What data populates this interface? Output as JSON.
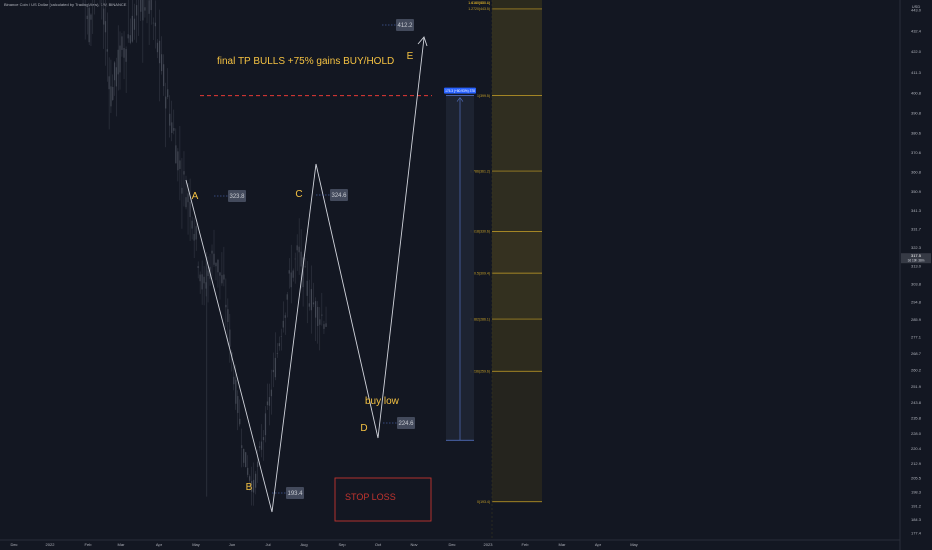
{
  "header": {
    "title": "Binance Coin / US Dollar (calculated by TradingView), 1W, BINANCE"
  },
  "chart_data": {
    "type": "candlestick",
    "x_ticks": [
      "Dec",
      "2022",
      "Feb",
      "Mar",
      "Apr",
      "May",
      "Jun",
      "Jul",
      "Aug",
      "Sep",
      "Oct",
      "Nov",
      "Dec",
      "2023",
      "Feb",
      "Mar",
      "Apr",
      "May"
    ],
    "y_ticks": [
      443.0,
      432.4,
      422.0,
      411.3,
      400.8,
      390.8,
      380.6,
      370.6,
      360.8,
      350.9,
      341.3,
      331.7,
      322.3,
      313.0,
      303.8,
      294.8,
      285.9,
      277.1,
      268.7,
      260.2,
      251.9,
      243.8,
      235.8,
      228.0,
      220.4,
      212.9,
      205.5,
      198.3,
      191.2,
      184.3,
      177.4
    ],
    "ylim": [
      176,
      446
    ],
    "top_label": "USD",
    "price_tag": {
      "value": "317.5",
      "countdown": "3d 19h 38m"
    },
    "waves": [
      {
        "label": "A",
        "price": 323.8
      },
      {
        "label": "B",
        "price": 193.4
      },
      {
        "label": "C",
        "price": 324.6
      },
      {
        "label": "D",
        "price": 224.6
      },
      {
        "label": "E",
        "price": 412.2
      }
    ],
    "target_line": 399.5,
    "annotations": {
      "target": "final TP BULLS +75% gains BUY/HOLD",
      "buy": "buy low",
      "stop": "STOP LOSS"
    },
    "range_box": {
      "from": 224.6,
      "to": 399.5,
      "label": "175.3 (+80.93%) 378"
    },
    "fib_levels": [
      {
        "label": "1.6180(530.4)",
        "price": 530.4
      },
      {
        "label": "1.4140(480.1)",
        "price": 480.1
      },
      {
        "label": "1.2720(443.5)",
        "price": 443.5
      },
      {
        "label": "1(399.5)",
        "price": 399.5
      },
      {
        "label": "0.786(361.2)",
        "price": 361.2
      },
      {
        "label": "0.618(330.6)",
        "price": 330.6
      },
      {
        "label": "0.5(309.4)",
        "price": 309.4
      },
      {
        "label": "0.382(286.1)",
        "price": 286.1
      },
      {
        "label": "0.236(259.6)",
        "price": 259.6
      },
      {
        "label": "0(193.4)",
        "price": 193.4
      }
    ],
    "colors": {
      "background": "#131722",
      "wave": "#d1d4dc",
      "label": "#f5c242",
      "target": "#e53935",
      "stop": "#c2342f",
      "tag": "#2962ff",
      "fib": "#c9a227"
    }
  }
}
